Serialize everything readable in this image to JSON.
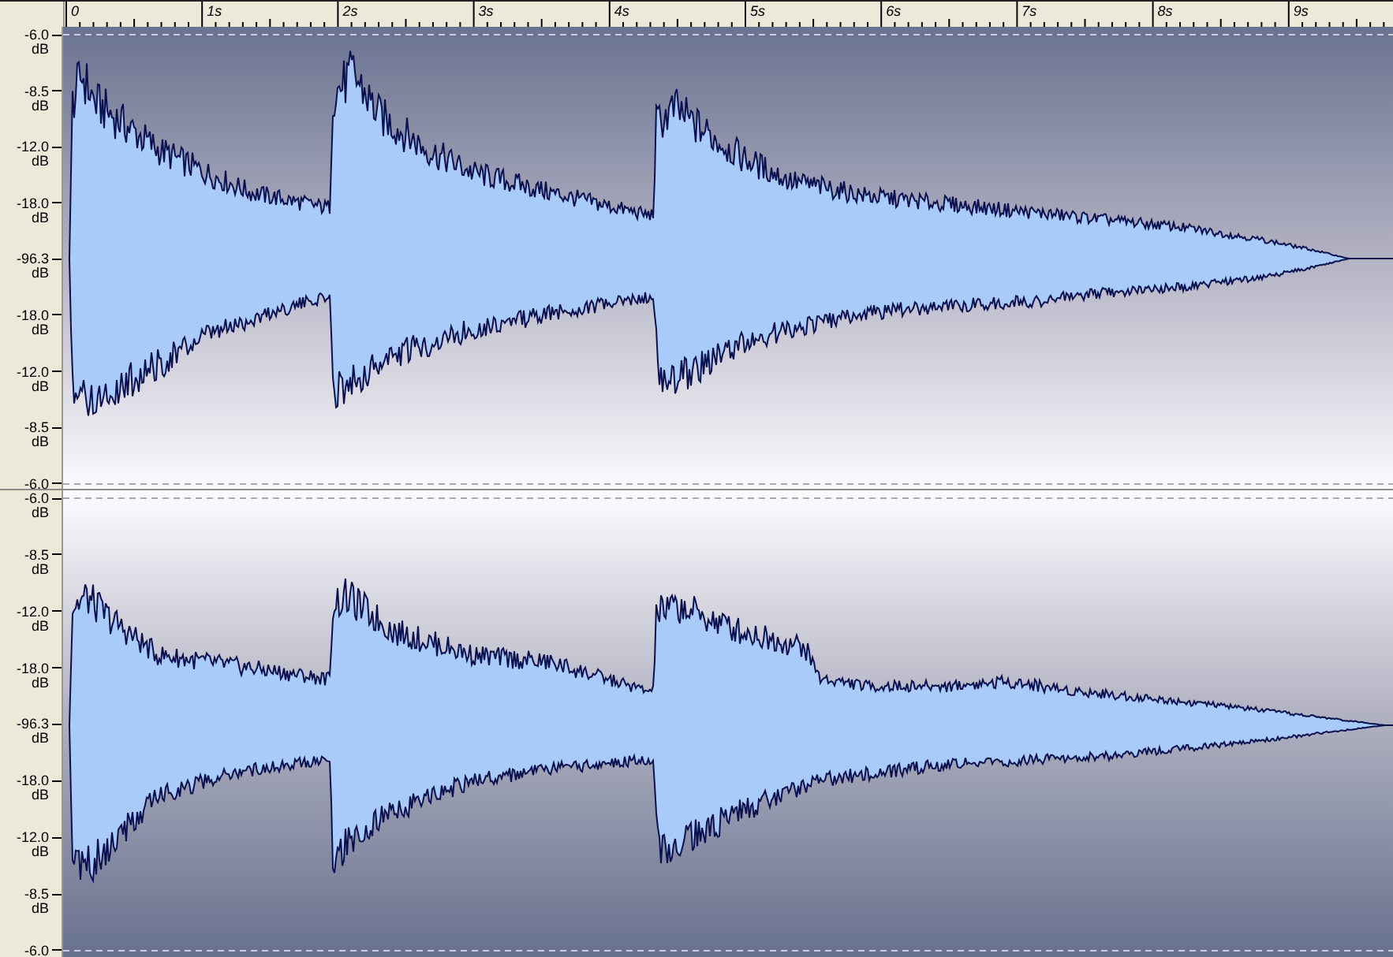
{
  "ruler": {
    "labels": [
      "0",
      "1s",
      "2s",
      "3s",
      "4s",
      "5s",
      "6s",
      "7s",
      "8s",
      "9s"
    ]
  },
  "channels": [
    {
      "scale": [
        {
          "value": "-6.0",
          "unit": "dB"
        },
        {
          "value": "-8.5",
          "unit": "dB"
        },
        {
          "value": "-12.0",
          "unit": "dB"
        },
        {
          "value": "-18.0",
          "unit": "dB"
        },
        {
          "value": "-96.3",
          "unit": "dB"
        },
        {
          "value": "-18.0",
          "unit": "dB"
        },
        {
          "value": "-12.0",
          "unit": "dB"
        },
        {
          "value": "-8.5",
          "unit": "dB"
        },
        {
          "value": "-6.0"
        }
      ]
    },
    {
      "scale": [
        {
          "value": "-6.0",
          "unit": "dB"
        },
        {
          "value": "-8.5",
          "unit": "dB"
        },
        {
          "value": "-12.0",
          "unit": "dB"
        },
        {
          "value": "-18.0",
          "unit": "dB"
        },
        {
          "value": "-96.3",
          "unit": "dB"
        },
        {
          "value": "-18.0",
          "unit": "dB"
        },
        {
          "value": "-12.0",
          "unit": "dB"
        },
        {
          "value": "-8.5",
          "unit": "dB"
        },
        {
          "value": "-6.0"
        }
      ]
    }
  ]
}
